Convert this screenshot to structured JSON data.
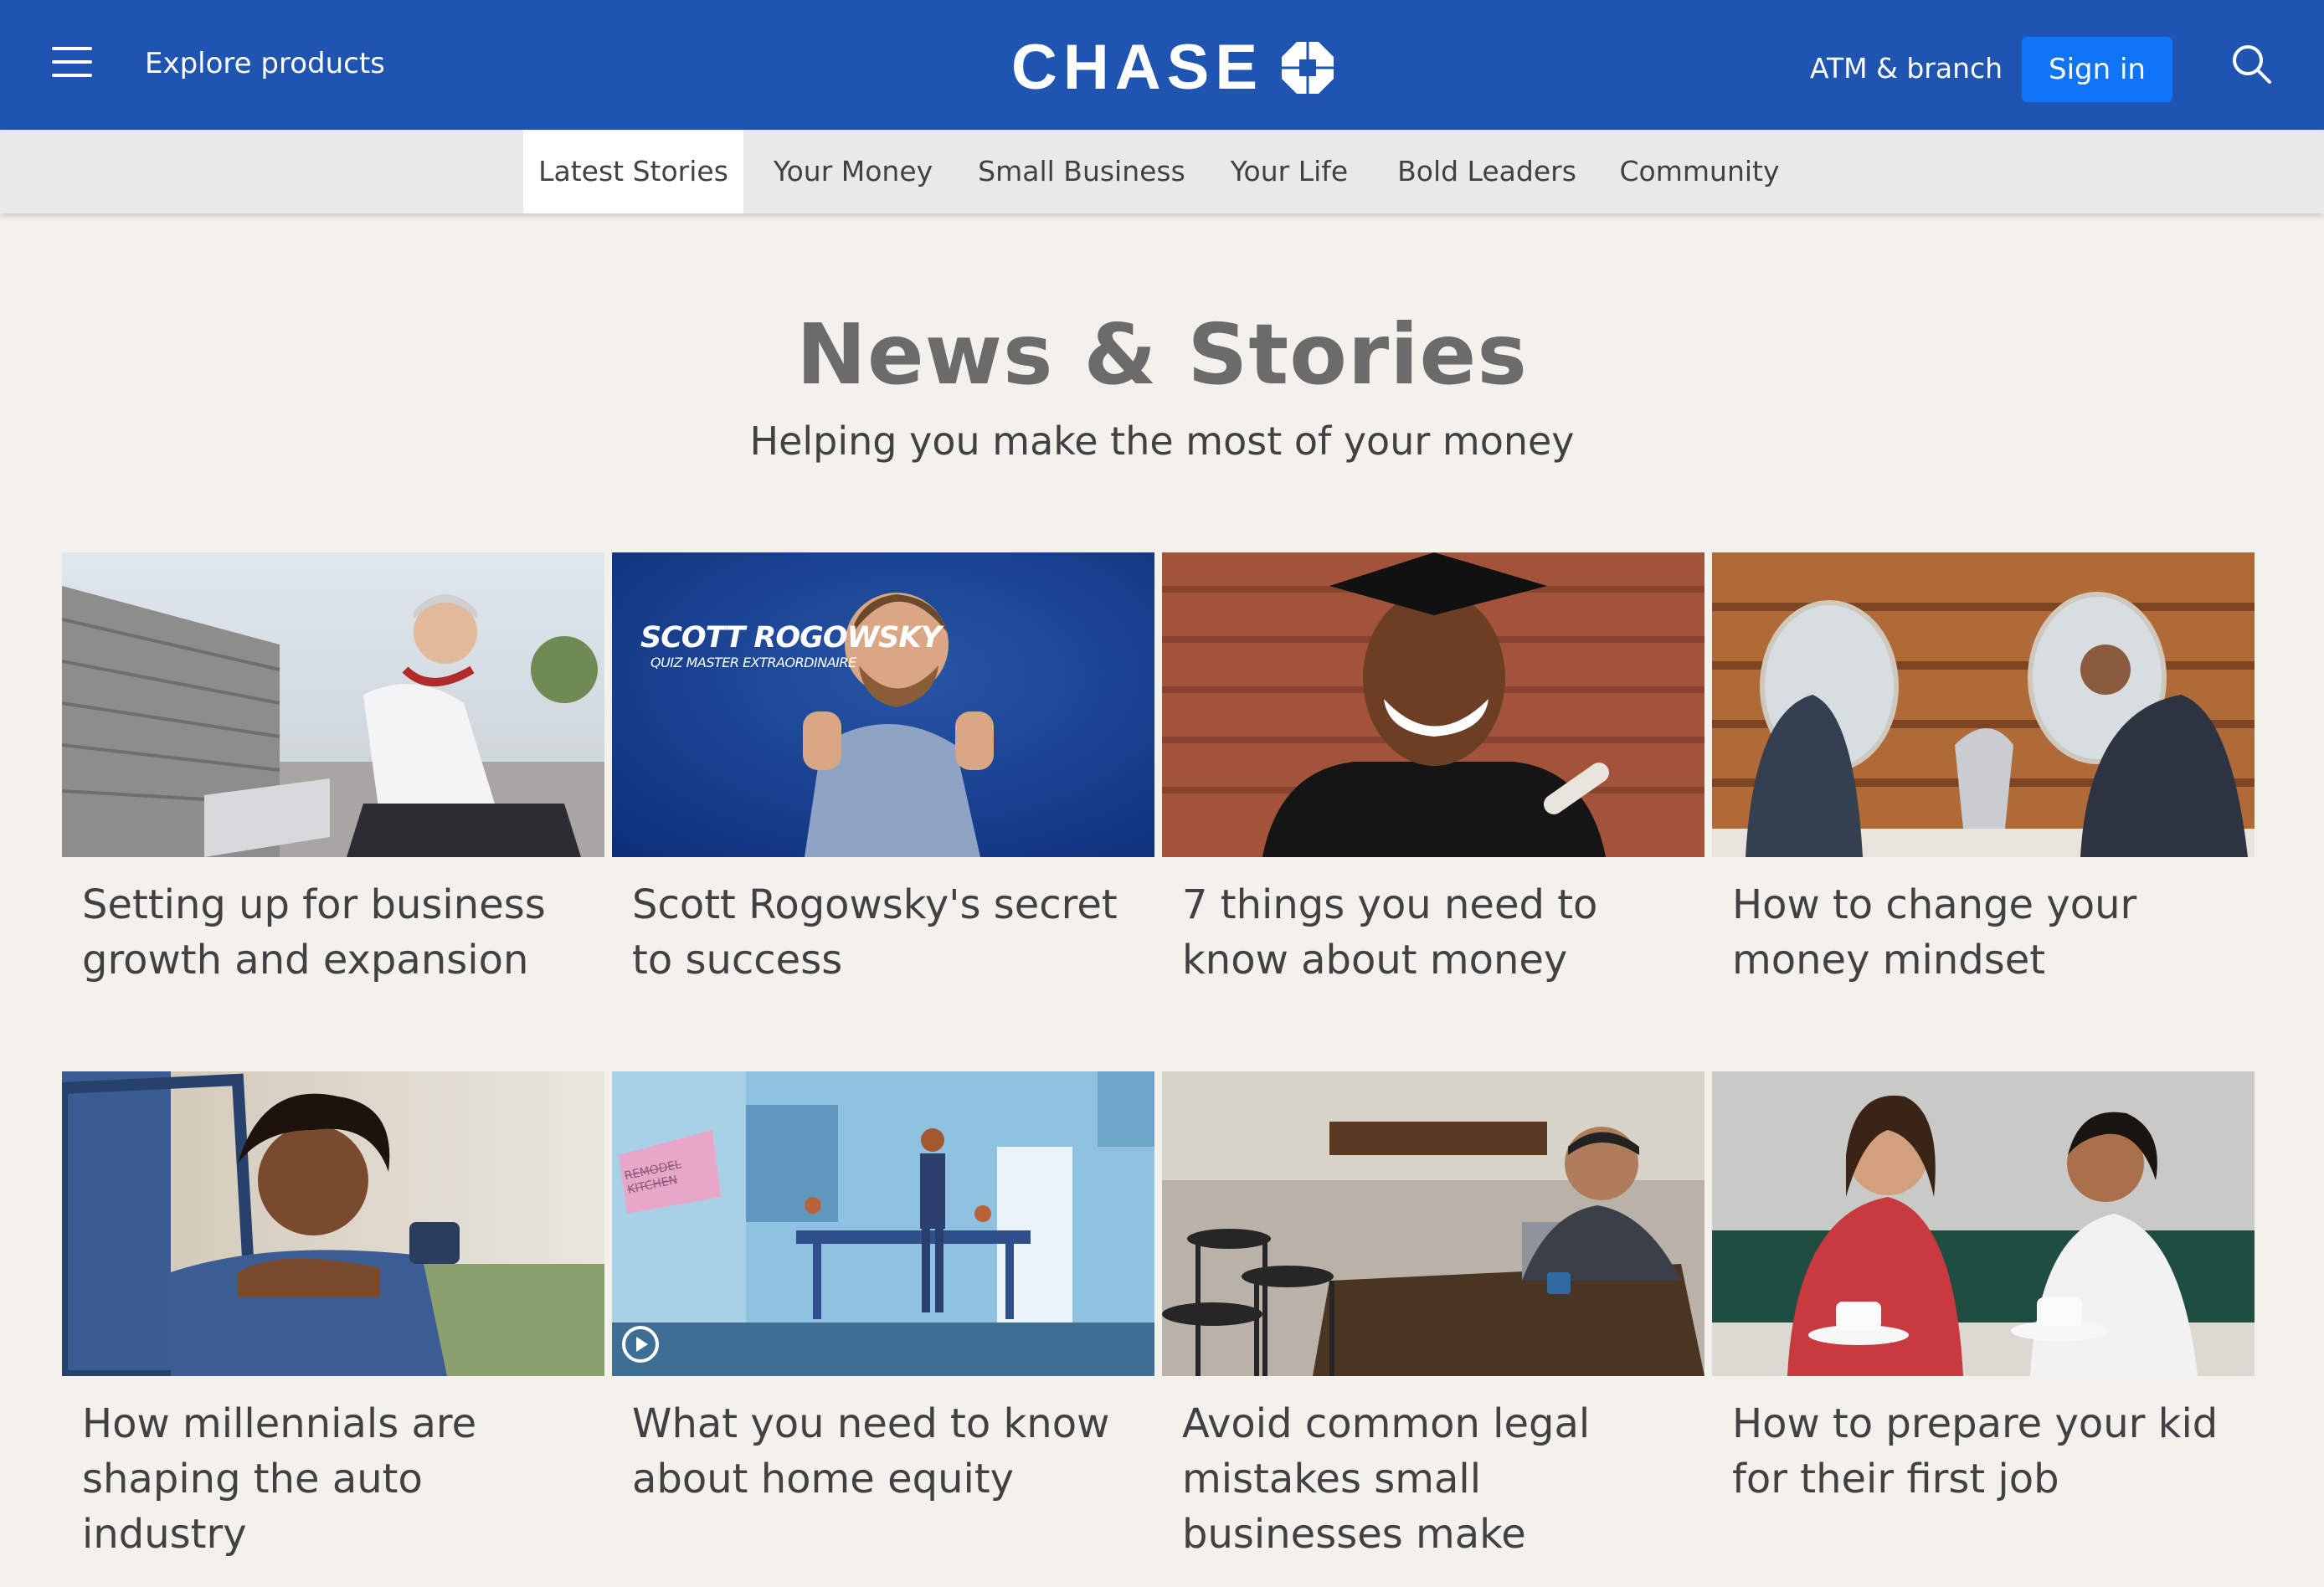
{
  "header": {
    "menu_icon": "hamburger-icon",
    "explore_label": "Explore products",
    "logo_text": "CHASE",
    "logo_icon": "chase-octagon-icon",
    "atm_label": "ATM & branch",
    "signin_label": "Sign in",
    "search_icon": "search-icon",
    "colors": {
      "bar": "#1f55b1",
      "signin": "#0f74f7"
    }
  },
  "subnav": {
    "tabs": [
      "Latest Stories",
      "Your Money",
      "Small Business",
      "Your Life",
      "Bold Leaders",
      "Community"
    ],
    "active": "Latest Stories"
  },
  "hero": {
    "title": "News & Stories",
    "subtitle": "Helping you make the most of your money"
  },
  "cards": [
    {
      "caption": "Setting up for business growth and expansion"
    },
    {
      "caption": "Scott Rogowsky's secret to success",
      "image_text": {
        "name": "SCOTT ROGOWSKY",
        "tagline": "QUIZ MASTER EXTRAORDINAIRE"
      }
    },
    {
      "caption": "7 things you need to know about money"
    },
    {
      "caption": "How to change your money mindset"
    },
    {
      "caption": "How millennials are shaping the auto industry"
    },
    {
      "caption": "What you need to know about home equity",
      "image_text": {
        "note": "REMODEL KITCHEN"
      },
      "play_icon": "play-icon"
    },
    {
      "caption": "Avoid common legal mistakes small businesses make"
    },
    {
      "caption": "How to prepare your kid for their first job"
    }
  ]
}
